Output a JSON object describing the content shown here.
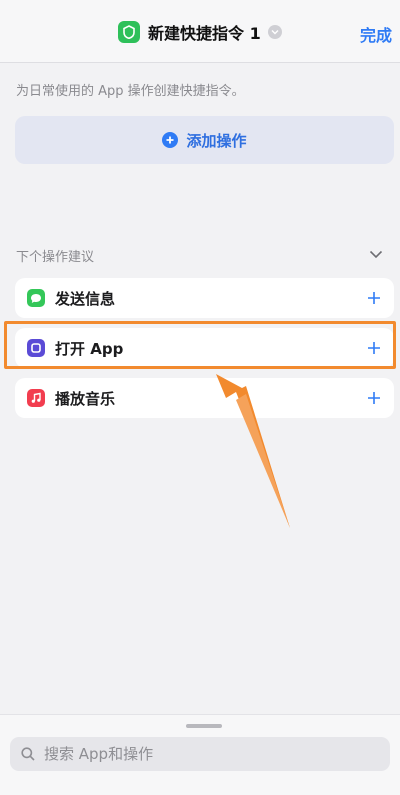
{
  "header": {
    "title": "新建快捷指令 1",
    "done_label": "完成"
  },
  "intro_text": "为日常使用的 App 操作创建快捷指令。",
  "add_action_label": "添加操作",
  "suggestions": {
    "title": "下个操作建议",
    "items": [
      {
        "label": "发送信息",
        "icon": "message-icon",
        "color": "#34c759"
      },
      {
        "label": "打开 App",
        "icon": "open-app-icon",
        "color": "#5b4bd6"
      },
      {
        "label": "播放音乐",
        "icon": "music-icon",
        "color": "#f23d4f"
      }
    ]
  },
  "search": {
    "placeholder": "搜索 App和操作"
  },
  "colors": {
    "accent": "#2f7bf5",
    "highlight": "#f28a2e"
  }
}
